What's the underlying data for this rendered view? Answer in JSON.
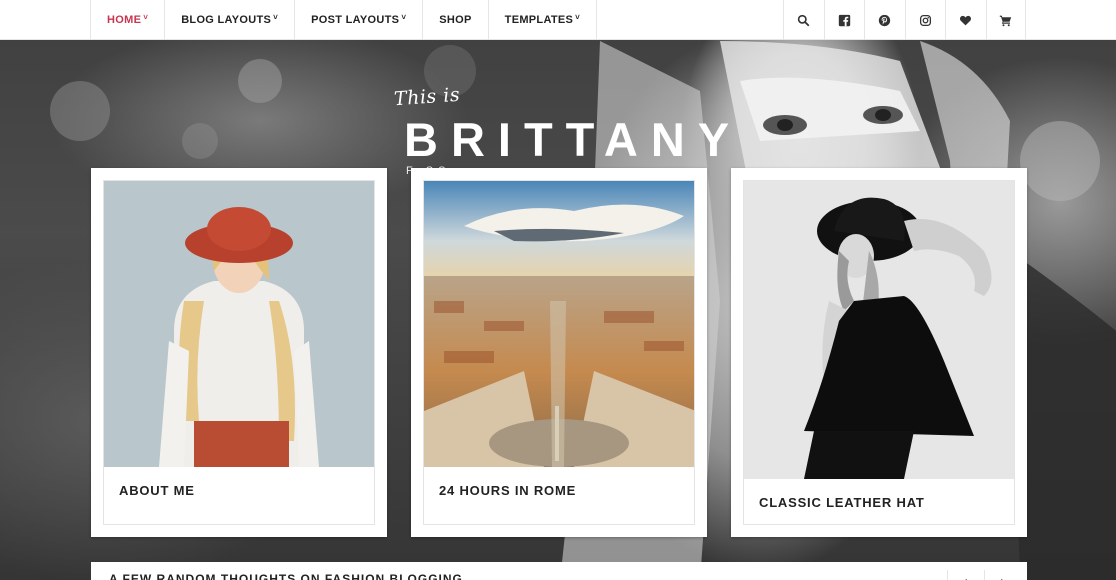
{
  "nav": {
    "items": [
      {
        "label": "HOME",
        "active": true,
        "dropdown": true
      },
      {
        "label": "BLOG LAYOUTS",
        "active": false,
        "dropdown": true
      },
      {
        "label": "POST LAYOUTS",
        "active": false,
        "dropdown": true
      },
      {
        "label": "SHOP",
        "active": false,
        "dropdown": false
      },
      {
        "label": "TEMPLATES",
        "active": false,
        "dropdown": true
      }
    ],
    "caret": "˅",
    "icons": [
      "search-icon",
      "facebook-icon",
      "pinterest-icon",
      "instagram-icon",
      "heart-icon",
      "cart-icon"
    ],
    "accent_color": "#c7364f"
  },
  "logo": {
    "script": "This is",
    "name": "BRITTANY",
    "tagline": "F                                   SS"
  },
  "cards": [
    {
      "title": "ABOUT ME"
    },
    {
      "title": "24 HOURS IN ROME"
    },
    {
      "title": "CLASSIC LEATHER HAT"
    }
  ],
  "bottom": {
    "heading": "A FEW RANDOM THOUGHTS ON FASHION BLOGGING",
    "prev": "‹",
    "next": "›"
  }
}
